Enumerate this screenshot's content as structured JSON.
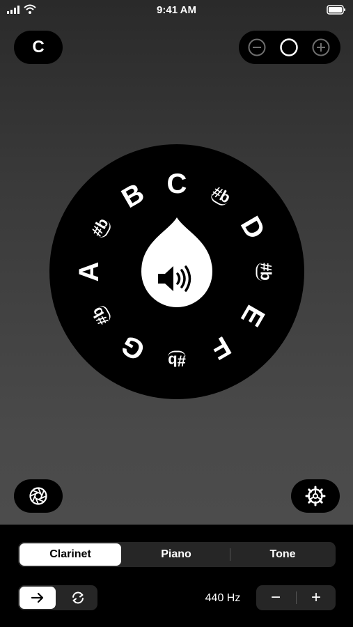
{
  "status_bar": {
    "time": "9:41 AM",
    "icons": [
      "cellular-signal-icon",
      "wifi-icon",
      "battery-icon"
    ]
  },
  "top": {
    "current_key": "C",
    "octave": {
      "decrease_icon": "minus-circle-icon",
      "center_icon": "circle-icon",
      "increase_icon": "plus-circle-icon"
    }
  },
  "wheel": {
    "center_icon": "speaker-wave-icon",
    "notes": [
      {
        "id": "C",
        "label": "C",
        "type": "natural"
      },
      {
        "id": "CsDb",
        "label": "#b",
        "type": "accidental"
      },
      {
        "id": "D",
        "label": "D",
        "type": "natural"
      },
      {
        "id": "DsEb",
        "label": "#b",
        "type": "accidental"
      },
      {
        "id": "E",
        "label": "E",
        "type": "natural"
      },
      {
        "id": "F",
        "label": "F",
        "type": "natural"
      },
      {
        "id": "FsGb",
        "label": "#b",
        "type": "accidental"
      },
      {
        "id": "G",
        "label": "G",
        "type": "natural"
      },
      {
        "id": "GsAb",
        "label": "#b",
        "type": "accidental"
      },
      {
        "id": "A",
        "label": "A",
        "type": "natural"
      },
      {
        "id": "AsBb",
        "label": "#b",
        "type": "accidental"
      },
      {
        "id": "B",
        "label": "B",
        "type": "natural"
      }
    ]
  },
  "side_buttons": {
    "left_icon": "aperture-icon",
    "right_icon": "gear-icon"
  },
  "instrument_tabs": [
    {
      "label": "Clarinet",
      "selected": true
    },
    {
      "label": "Piano",
      "selected": false
    },
    {
      "label": "Tone",
      "selected": false
    }
  ],
  "play_mode": [
    {
      "icon": "arrow-right-icon",
      "selected": true
    },
    {
      "icon": "loop-icon",
      "selected": false
    }
  ],
  "reference_pitch": {
    "label": "440 Hz",
    "decrease": "−",
    "increase": "+"
  }
}
